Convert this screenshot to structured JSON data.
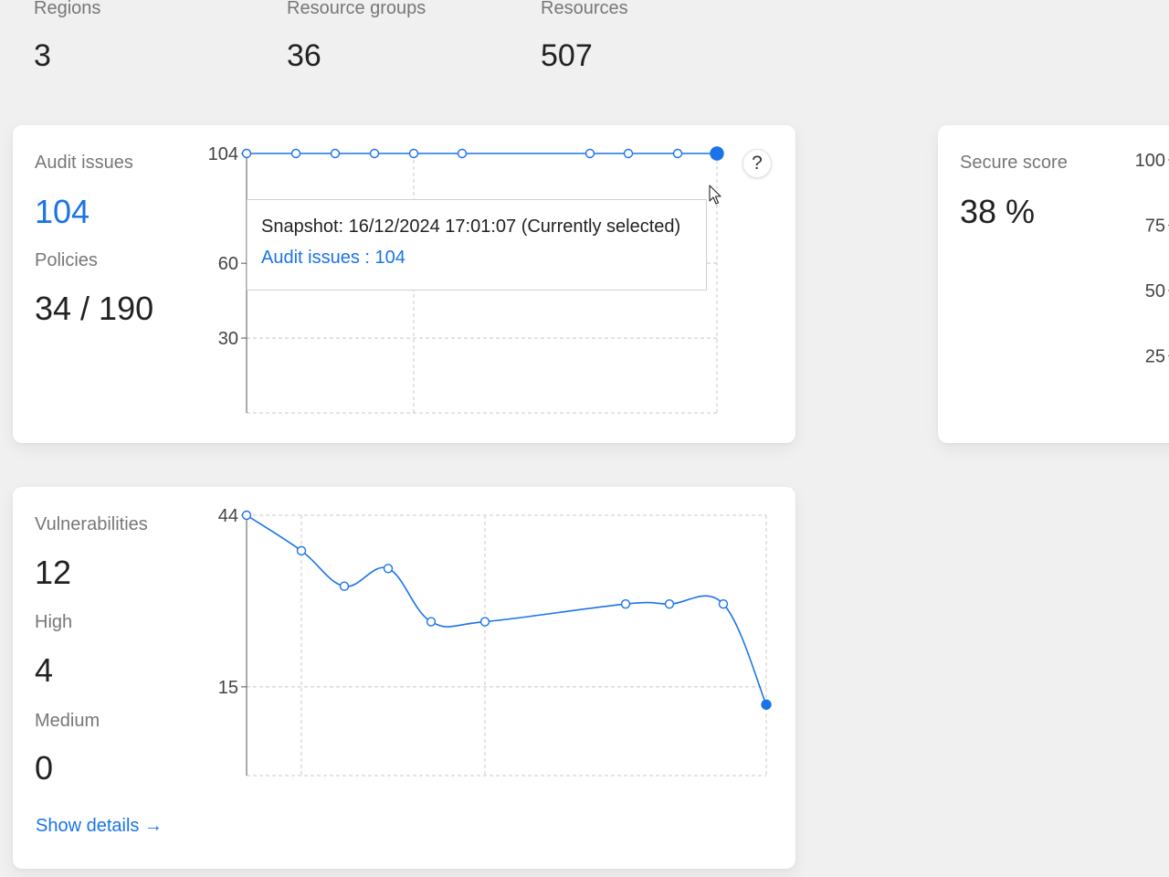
{
  "stats": [
    {
      "label": "Regions",
      "value": "3"
    },
    {
      "label": "Resource groups",
      "value": "36"
    },
    {
      "label": "Resources",
      "value": "507"
    }
  ],
  "audit": {
    "issues_label": "Audit issues",
    "issues_value": "104",
    "policies_label": "Policies",
    "policies_value": "34 / 190",
    "help_label": "?",
    "tooltip": {
      "snapshot": "Snapshot: 16/12/2024 17:01:07 (Currently selected)",
      "value": "Audit issues : 104"
    }
  },
  "secure": {
    "label": "Secure score",
    "value": "38 %"
  },
  "vulns": {
    "label": "Vulnerabilities",
    "value": "12",
    "high_label": "High",
    "high_value": "4",
    "medium_label": "Medium",
    "medium_value": "0",
    "show_details": "Show details",
    "arrow": "→"
  },
  "chart_data": [
    {
      "type": "line",
      "ylim": [
        0,
        104
      ],
      "yticks": [
        "104",
        "60",
        "30"
      ],
      "ytick_values": [
        104,
        60,
        30
      ],
      "series": [
        {
          "values": [
            104,
            104,
            104,
            104,
            104,
            104,
            104,
            104,
            104,
            104
          ]
        }
      ],
      "selected_index": 9,
      "accent": "#1a73e8"
    },
    {
      "type": "line",
      "ylim": [
        0,
        100
      ],
      "yticks": [
        "100",
        "75",
        "50",
        "25"
      ],
      "ytick_values": [
        100,
        75,
        50,
        25
      ],
      "accent": "#1a73e8"
    },
    {
      "type": "line",
      "ylim": [
        0,
        44
      ],
      "yticks": [
        "44",
        "15"
      ],
      "ytick_values": [
        44,
        15
      ],
      "series": [
        {
          "values": [
            44,
            38,
            32,
            35,
            26,
            26,
            29,
            29,
            29,
            12
          ]
        }
      ],
      "selected_index": 9,
      "accent": "#1a73e8"
    }
  ]
}
